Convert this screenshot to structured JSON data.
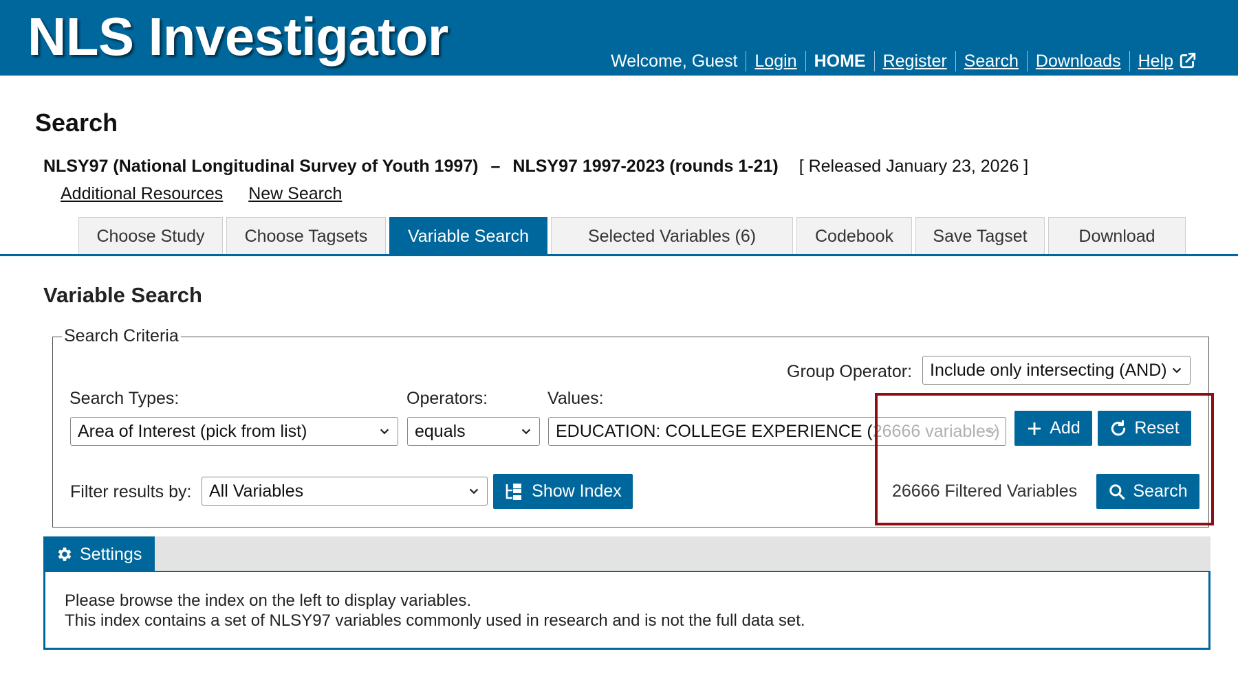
{
  "header": {
    "brand": "NLS Investigator",
    "welcome": "Welcome, Guest",
    "nav": {
      "login": "Login",
      "home": "HOME",
      "register": "Register",
      "search": "Search",
      "downloads": "Downloads",
      "help": "Help"
    }
  },
  "page": {
    "title": "Search",
    "study": "NLSY97 (National Longitudinal Survey of Youth 1997)",
    "dash": "–",
    "release": "NLSY97 1997-2023 (rounds 1-21)",
    "released": "[ Released January 23, 2026 ]",
    "links": {
      "additional_resources": "Additional Resources",
      "new_search": "New Search"
    }
  },
  "tabs": {
    "choose_study": "Choose Study",
    "choose_tagsets": "Choose Tagsets",
    "variable_search": "Variable Search",
    "selected_variables": "Selected Variables (6)",
    "codebook": "Codebook",
    "save_tagset": "Save Tagset",
    "download": "Download",
    "active": "Variable Search"
  },
  "variable_search": {
    "title": "Variable Search",
    "legend": "Search Criteria",
    "group_operator_label": "Group Operator:",
    "group_operator_value": "Include only intersecting (AND)",
    "search_types_label": "Search Types:",
    "search_types_value": "Area of Interest (pick from list)",
    "operators_label": "Operators:",
    "operators_value": "equals",
    "values_label": "Values:",
    "values_value": "EDUCATION: COLLEGE EXPERIENCE (",
    "values_overflow": "26666 variables)",
    "filter_label": "Filter results by:",
    "filter_value": "All Variables",
    "show_index_button": "Show Index",
    "add_button": "Add",
    "reset_button": "Reset",
    "filtered_count": "26666 Filtered Variables",
    "search_button": "Search"
  },
  "settings": {
    "tab_label": "Settings",
    "message_line1": "Please browse the index on the left to display variables.",
    "message_line2": "This index contains a set of NLSY97 variables commonly used in research and is not the full data set."
  },
  "colors": {
    "brand_blue": "#00679c",
    "highlight_red": "#8f0e12"
  },
  "icons": [
    "external-link-icon",
    "chevron-down-icon",
    "plus-icon",
    "reset-icon",
    "tree-index-icon",
    "search-icon",
    "gear-icon"
  ]
}
